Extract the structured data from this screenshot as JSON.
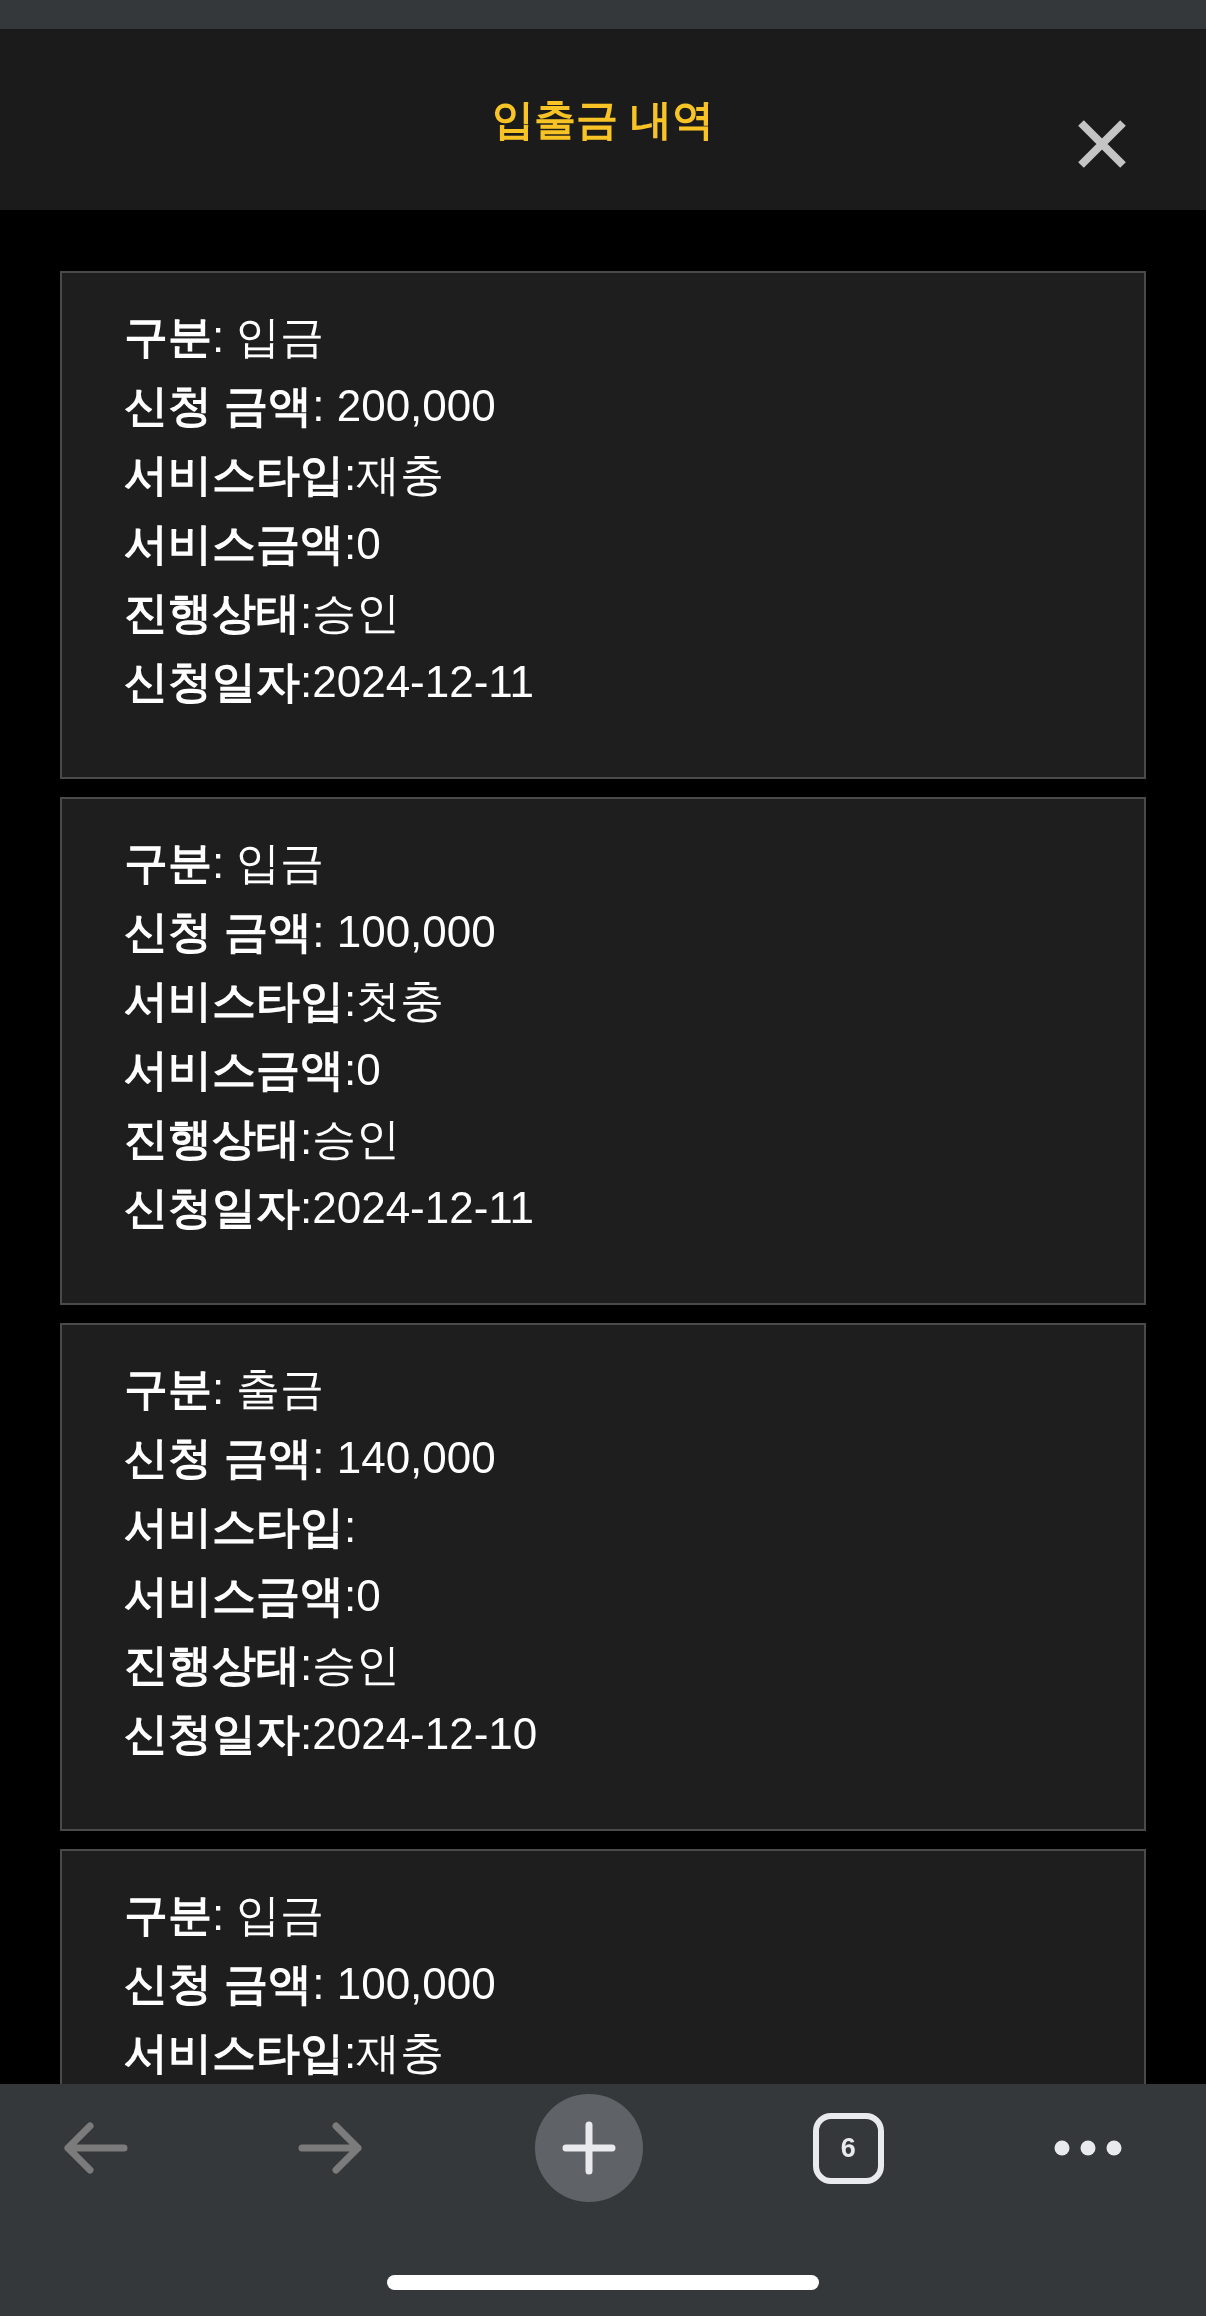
{
  "header": {
    "title": "입출금 내역"
  },
  "transactions": [
    {
      "fields": [
        {
          "label": "**구분**: ",
          "value": "입금"
        },
        {
          "label": "**신청 금액**: ",
          "value": "200,000"
        },
        {
          "label": "**서비스타입**:",
          "value": "재충"
        },
        {
          "label": "**서비스금액**:",
          "value": "0"
        },
        {
          "label": "**진행상태**:",
          "value": "승인"
        },
        {
          "label": "**신청일자**:",
          "value": "2024-12-11"
        }
      ]
    },
    {
      "fields": [
        {
          "label": "**구분**: ",
          "value": "입금"
        },
        {
          "label": "**신청 금액**: ",
          "value": "100,000"
        },
        {
          "label": "**서비스타입**:",
          "value": "첫충"
        },
        {
          "label": "**서비스금액**:",
          "value": "0"
        },
        {
          "label": "**진행상태**:",
          "value": "승인"
        },
        {
          "label": "**신청일자**:",
          "value": "2024-12-11"
        }
      ]
    },
    {
      "fields": [
        {
          "label": "**구분**: ",
          "value": "출금"
        },
        {
          "label": "**신청 금액**: ",
          "value": "140,000"
        },
        {
          "label": "**서비스타입**:"
        },
        {
          "label": "**서비스금액**:",
          "value": "0"
        },
        {
          "label": "**진행상태**:",
          "value": "승인"
        },
        {
          "label": "**신청일자**:",
          "value": "2024-12-10"
        }
      ]
    },
    {
      "fields": [
        {
          "label": "**구분**: ",
          "value": "입금"
        },
        {
          "label": "**신청 금액**: ",
          "value": "100,000"
        },
        {
          "label": "**서비스타입**:",
          "value": "재충"
        }
      ]
    }
  ],
  "browser_toolbar": {
    "buttons": [
      {
        "kind": "back",
        "disabled": true
      },
      {
        "kind": "forward",
        "disabled": true
      },
      {
        "kind": "new_tab",
        "disabled": false
      },
      {
        "kind": "tabs",
        "label": "6",
        "disabled": false
      },
      {
        "kind": "menu",
        "disabled": false
      }
    ]
  }
}
